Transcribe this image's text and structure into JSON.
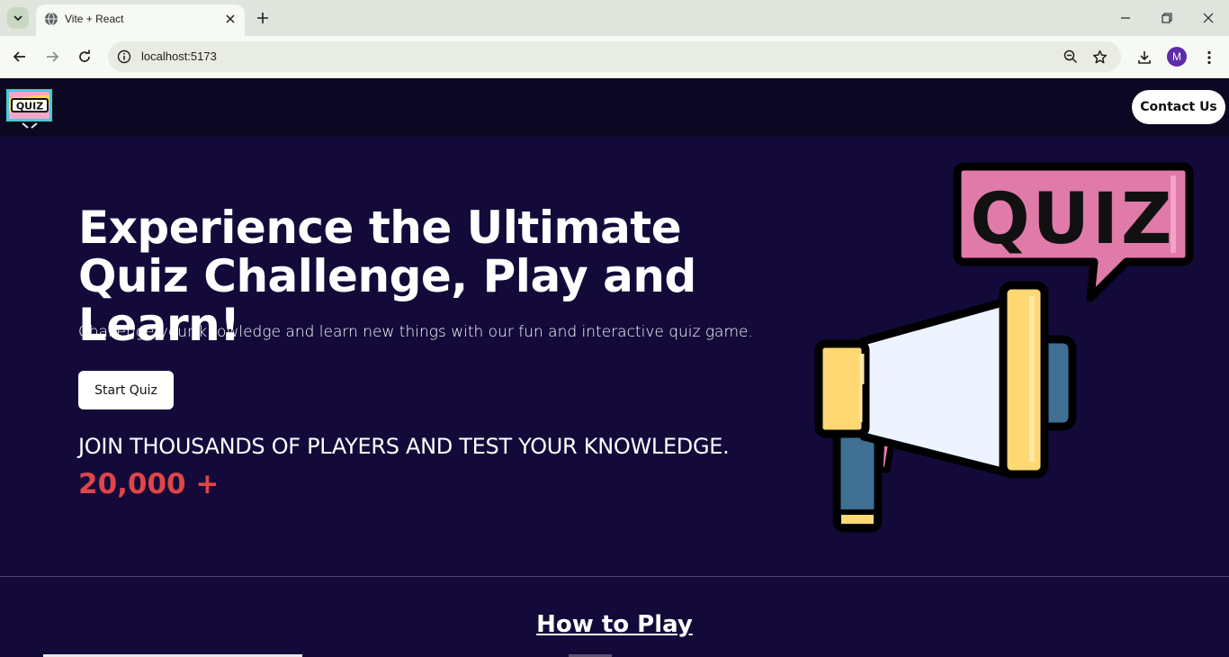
{
  "browser": {
    "tab_title": "Vite + React",
    "url": "localhost:5173",
    "profile_initial": "M"
  },
  "header": {
    "logo_text": "QUIZ",
    "contact_label": "Contact Us"
  },
  "hero": {
    "title": "Experience the Ultimate Quiz Challenge, Play and Learn!",
    "subtitle": "Challenge your knowledge and learn new things with our fun and interactive quiz game.",
    "start_label": "Start Quiz",
    "join_text": "JOIN THOUSANDS OF PLAYERS AND TEST YOUR KNOWLEDGE.",
    "players_count": "20,000 +",
    "illustration_text": "QUIZ"
  },
  "how_to_play": {
    "title": "How to Play"
  },
  "colors": {
    "page_bg": "#140a3a",
    "header_bg": "#0c0722",
    "accent_red": "#e0454a",
    "quiz_pink": "#e07aa8",
    "horn_yellow": "#ffd873"
  }
}
